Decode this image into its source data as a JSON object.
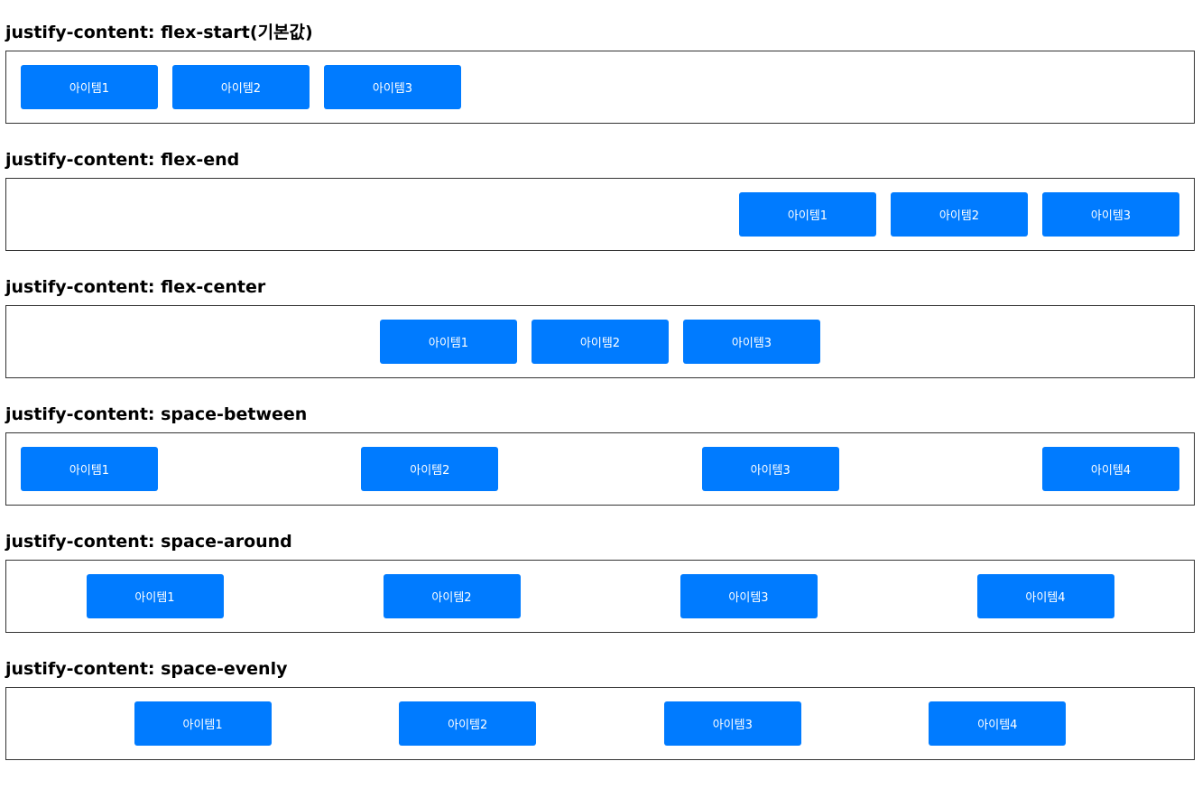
{
  "sections": [
    {
      "title": "justify-content: flex-start(기본값)",
      "items": [
        "아이템1",
        "아이템2",
        "아이템3"
      ]
    },
    {
      "title": "justify-content: flex-end",
      "items": [
        "아이템1",
        "아이템2",
        "아이템3"
      ]
    },
    {
      "title": "justify-content: flex-center",
      "items": [
        "아이템1",
        "아이템2",
        "아이템3"
      ]
    },
    {
      "title": "justify-content: space-between",
      "items": [
        "아이템1",
        "아이템2",
        "아이템3",
        "아이템4"
      ]
    },
    {
      "title": "justify-content: space-around",
      "items": [
        "아이템1",
        "아이템2",
        "아이템3",
        "아이템4"
      ]
    },
    {
      "title": "justify-content: space-evenly",
      "items": [
        "아이템1",
        "아이템2",
        "아이템3",
        "아이템4"
      ]
    }
  ],
  "colors": {
    "item_background": "#007bff",
    "item_text": "#ffffff",
    "container_border": "#333333"
  }
}
